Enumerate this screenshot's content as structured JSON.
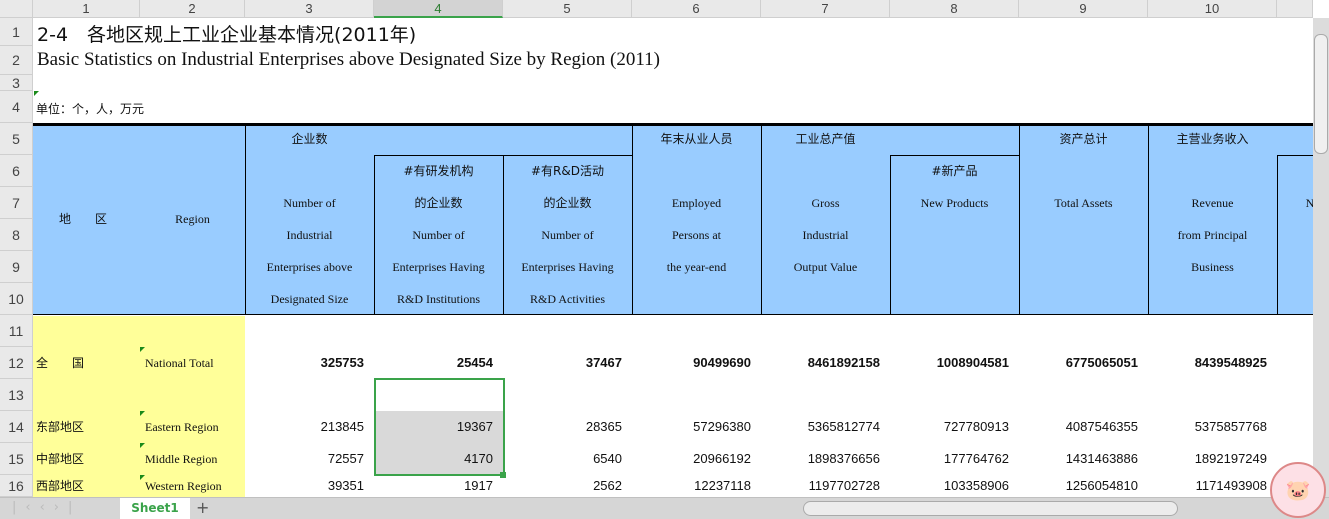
{
  "columns": [
    "1",
    "2",
    "3",
    "4",
    "5",
    "6",
    "7",
    "8",
    "9",
    "10"
  ],
  "rows": [
    "1",
    "2",
    "3",
    "4",
    "5",
    "6",
    "7",
    "8",
    "9",
    "10",
    "11",
    "12",
    "13",
    "14",
    "15",
    "16"
  ],
  "title_cn": "2-4　各地区规上工业企业基本情况(2011年)",
  "title_en": "Basic Statistics on Industrial Enterprises above Designated Size by Region (2011)",
  "unit": "单位：个，人，万元",
  "headers": {
    "region_cn": "地　　区",
    "region_en": "Region",
    "enterprises_cn": "企业数",
    "enterprises_en": [
      "Number of",
      "Industrial",
      "Enterprises above",
      "Designated Size"
    ],
    "rd_inst_cn": [
      "#有研发机构",
      "的企业数"
    ],
    "rd_inst_en": [
      "Number of",
      "Enterprises Having",
      "R&D Institutions"
    ],
    "rd_act_cn": [
      "#有R&D活动",
      "的企业数"
    ],
    "rd_act_en": [
      "Number of",
      "Enterprises Having",
      "R&D Activities"
    ],
    "employed_cn": "年末从业人员",
    "employed_en": [
      "Employed",
      "Persons at",
      "the year-end"
    ],
    "gross_cn": "工业总产值",
    "gross_en": [
      "Gross",
      "Industrial",
      "Output Value"
    ],
    "newprod_cn": "#新产品",
    "newprod_en": "New Products",
    "assets_cn": "资产总计",
    "assets_en": "Total Assets",
    "revenue_cn": "主营业务收入",
    "revenue_en": [
      "Revenue",
      "from Principal",
      "Business"
    ],
    "partial": "N"
  },
  "data_rows": [
    {
      "row": 12,
      "cn": "全　　国",
      "en": "National Total",
      "bold": true,
      "values": [
        "325753",
        "25454",
        "37467",
        "90499690",
        "8461892158",
        "1008904581",
        "6775065051",
        "8439548925"
      ]
    },
    {
      "row": 14,
      "cn": "东部地区",
      "en": "Eastern Region",
      "values": [
        "213845",
        "19367",
        "28365",
        "57296380",
        "5365812774",
        "727780913",
        "4087546355",
        "5375857768"
      ]
    },
    {
      "row": 15,
      "cn": "中部地区",
      "en": "Middle Region",
      "values": [
        "72557",
        "4170",
        "6540",
        "20966192",
        "1898376656",
        "177764762",
        "1431463886",
        "1892197249"
      ]
    },
    {
      "row": 16,
      "cn": "西部地区",
      "en": "Western Region",
      "values": [
        "39351",
        "1917",
        "2562",
        "12237118",
        "1197702728",
        "103358906",
        "1256054810",
        "1171493908"
      ]
    }
  ],
  "sheet_tab": "Sheet1",
  "add_sheet": "+"
}
